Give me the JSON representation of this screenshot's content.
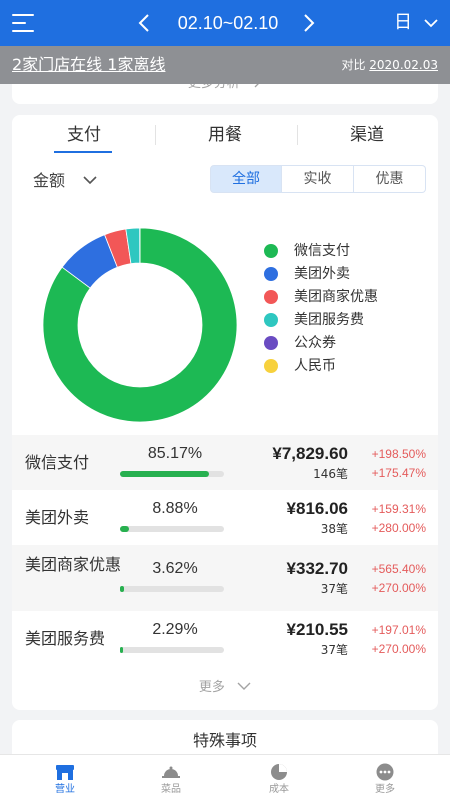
{
  "header": {
    "date_range": "02.10~02.10",
    "period": "日"
  },
  "banner": {
    "status": "2家门店在线 1家离线",
    "compare_prefix": "对比",
    "compare_date": "2020.02.03"
  },
  "summary": {
    "more_analysis": "更多分析"
  },
  "tabs": [
    {
      "label": "支付",
      "active": true
    },
    {
      "label": "用餐",
      "active": false
    },
    {
      "label": "渠道",
      "active": false
    }
  ],
  "metric_select": "金额",
  "filters": [
    {
      "label": "全部",
      "active": true
    },
    {
      "label": "实收",
      "active": false
    },
    {
      "label": "优惠",
      "active": false
    }
  ],
  "chart_data": {
    "type": "pie",
    "donut": true,
    "categories": [
      "微信支付",
      "美团外卖",
      "美团商家优惠",
      "美团服务费",
      "公众券",
      "人民币"
    ],
    "values": [
      85.17,
      8.88,
      3.62,
      2.29,
      0.04,
      0.0
    ],
    "colors": [
      "#1db954",
      "#2e6fe0",
      "#f25757",
      "#2ec7c0",
      "#6a4cc2",
      "#f7d13d"
    ],
    "legend_position": "right"
  },
  "rows": [
    {
      "name": "微信支付",
      "pct": "85.17%",
      "share": 85.17,
      "amount": "¥7,829.60",
      "count": "146笔",
      "change1": "+198.50%",
      "change2": "+175.47%"
    },
    {
      "name": "美团外卖",
      "pct": "8.88%",
      "share": 8.88,
      "amount": "¥816.06",
      "count": "38笔",
      "change1": "+159.31%",
      "change2": "+280.00%"
    },
    {
      "name": "美团商家优惠",
      "pct": "3.62%",
      "share": 3.62,
      "amount": "¥332.70",
      "count": "37笔",
      "change1": "+565.40%",
      "change2": "+270.00%"
    },
    {
      "name": "美团服务费",
      "pct": "2.29%",
      "share": 2.29,
      "amount": "¥210.55",
      "count": "37笔",
      "change1": "+197.01%",
      "change2": "+270.00%"
    }
  ],
  "more": "更多",
  "special": {
    "title": "特殊事项"
  },
  "tabbar": [
    {
      "label": "营业",
      "icon": "store-icon",
      "active": true
    },
    {
      "label": "菜品",
      "icon": "dish-cloche-icon",
      "active": false
    },
    {
      "label": "成本",
      "icon": "pie-chart-icon",
      "active": false
    },
    {
      "label": "更多",
      "icon": "more-dots-icon",
      "active": false
    }
  ]
}
